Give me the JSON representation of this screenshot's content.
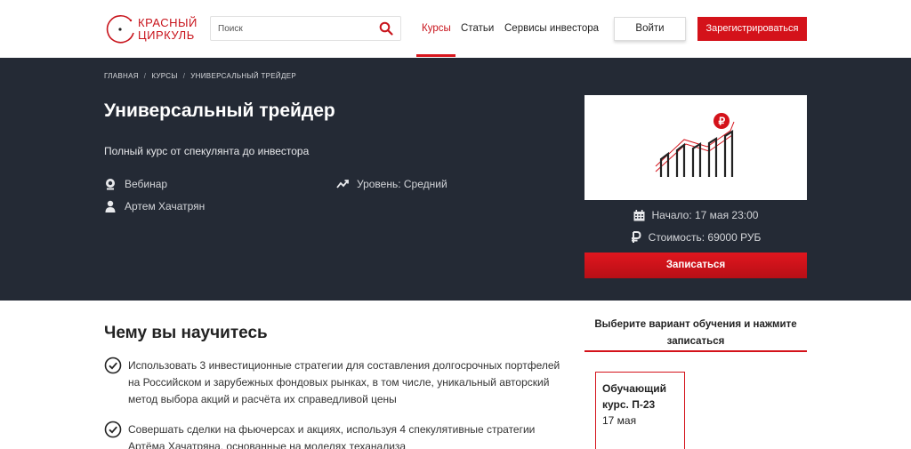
{
  "header": {
    "logo_line1": "КРАСНЫЙ",
    "logo_line2": "ЦИРКУЛЬ",
    "search_placeholder": "Поиск",
    "nav": [
      "Курсы",
      "Статьи",
      "Сервисы инвестора"
    ],
    "login_label": "Войти",
    "register_label": "Зарегистрироваться"
  },
  "breadcrumb": [
    "ГЛАВНАЯ",
    "КУРСЫ",
    "УНИВЕРСАЛЬНЫЙ ТРЕЙДЕР"
  ],
  "breadcrumb_sep": "/",
  "course": {
    "title": "Универсальный трейдер",
    "subtitle": "Полный курс от спекулянта до инвестора",
    "format": "Вебинар",
    "level": "Уровень: Средний",
    "author": "Артем Хачатрян",
    "start": "Начало: 17 мая 23:00",
    "price": "Стоимость: 69000 РУБ",
    "enroll_label": "Записаться"
  },
  "learn": {
    "title": "Чему вы научитесь",
    "items": [
      "Использовать 3 инвестиционные стратегии для составления долгосрочных портфелей на Российском и зарубежных фондовых рынках, в том числе, уникальный авторский метод выбора акций и расчёта их справедливой цены",
      "Совершать сделки на фьючерсах и акциях, используя 4 спекулятивные стратегии Артёма Хачатряна, основанные на моделях теханализа"
    ]
  },
  "sidebar": {
    "heading": "Выберите вариант обучения и нажмите записаться",
    "variant": {
      "title": "Обучающий курс. П-23",
      "date": "17 мая"
    }
  },
  "colors": {
    "brand_red": "#d4121a",
    "hero_bg": "#242a35"
  }
}
